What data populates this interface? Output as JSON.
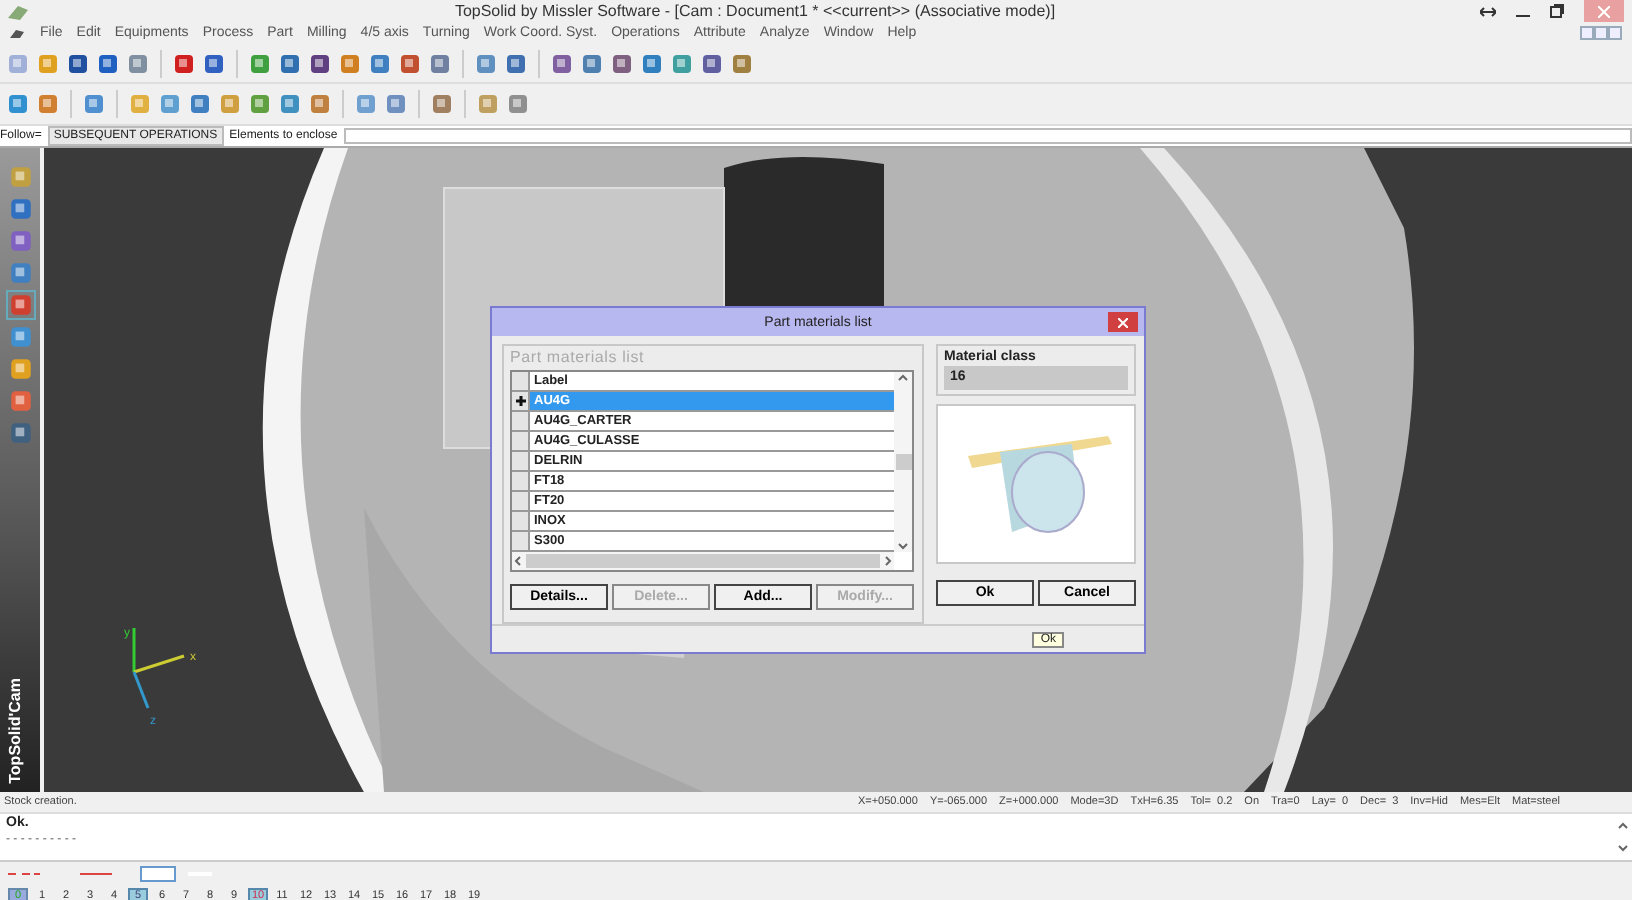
{
  "window": {
    "title": "TopSolid by Missler Software - [Cam : Document1 *  <<current>> (Associative mode)]"
  },
  "menu": [
    "File",
    "Edit",
    "Equipments",
    "Process",
    "Part",
    "Milling",
    "4/5 axis",
    "Turning",
    "Work Coord. Syst.",
    "Operations",
    "Attribute",
    "Analyze",
    "Window",
    "Help"
  ],
  "follow_bar": {
    "label": "Follow=",
    "value": "SUBSEQUENT OPERATIONS",
    "prompt": "Elements to enclose"
  },
  "sidebar": {
    "brand": "TopSolid'Cam"
  },
  "axes": [
    "y",
    "x",
    "z"
  ],
  "dialog": {
    "title": "Part materials list",
    "group_title": "Part materials list",
    "column": "Label",
    "rows": [
      {
        "label": "AU4G",
        "selected": true
      },
      {
        "label": "AU4G_CARTER",
        "selected": false
      },
      {
        "label": "AU4G_CULASSE",
        "selected": false
      },
      {
        "label": "DELRIN",
        "selected": false
      },
      {
        "label": "FT18",
        "selected": false
      },
      {
        "label": "FT20",
        "selected": false
      },
      {
        "label": "INOX",
        "selected": false
      },
      {
        "label": "S300",
        "selected": false
      }
    ],
    "material_class": {
      "label": "Material class",
      "value": "16"
    },
    "buttons": [
      {
        "label": "Details...",
        "disabled": false
      },
      {
        "label": "Delete...",
        "disabled": true
      },
      {
        "label": "Add...",
        "disabled": false
      },
      {
        "label": "Modify...",
        "disabled": true
      }
    ],
    "ok": "Ok",
    "cancel": "Cancel",
    "status": "Ok"
  },
  "status_line": {
    "message": "Stock creation.",
    "fields": [
      "X=+050.000",
      "Y=-065.000",
      "Z=+000.000",
      "Mode=3D",
      "TxH=6.35",
      "Tol=  0.2",
      "On",
      "Tra=0",
      "Lay=  0",
      "Dec=  3",
      "Inv=Hid",
      "Mes=Elt",
      "Mat=steel"
    ]
  },
  "command": {
    "lines": [
      "Ok.",
      "- - - - - - - - - -"
    ]
  },
  "layers": [
    {
      "label": "0",
      "kind": "current"
    },
    {
      "label": "1",
      "kind": "plain"
    },
    {
      "label": "2",
      "kind": "plain"
    },
    {
      "label": "3",
      "kind": "plain"
    },
    {
      "label": "4",
      "kind": "plain"
    },
    {
      "label": "5",
      "kind": "marked"
    },
    {
      "label": "6",
      "kind": "plain"
    },
    {
      "label": "7",
      "kind": "plain"
    },
    {
      "label": "8",
      "kind": "plain"
    },
    {
      "label": "9",
      "kind": "plain"
    },
    {
      "label": "10",
      "kind": "alert"
    },
    {
      "label": "11",
      "kind": "plain"
    },
    {
      "label": "12",
      "kind": "plain"
    },
    {
      "label": "13",
      "kind": "plain"
    },
    {
      "label": "14",
      "kind": "plain"
    },
    {
      "label": "15",
      "kind": "plain"
    },
    {
      "label": "16",
      "kind": "plain"
    },
    {
      "label": "17",
      "kind": "plain"
    },
    {
      "label": "18",
      "kind": "plain"
    },
    {
      "label": "19",
      "kind": "plain"
    }
  ]
}
